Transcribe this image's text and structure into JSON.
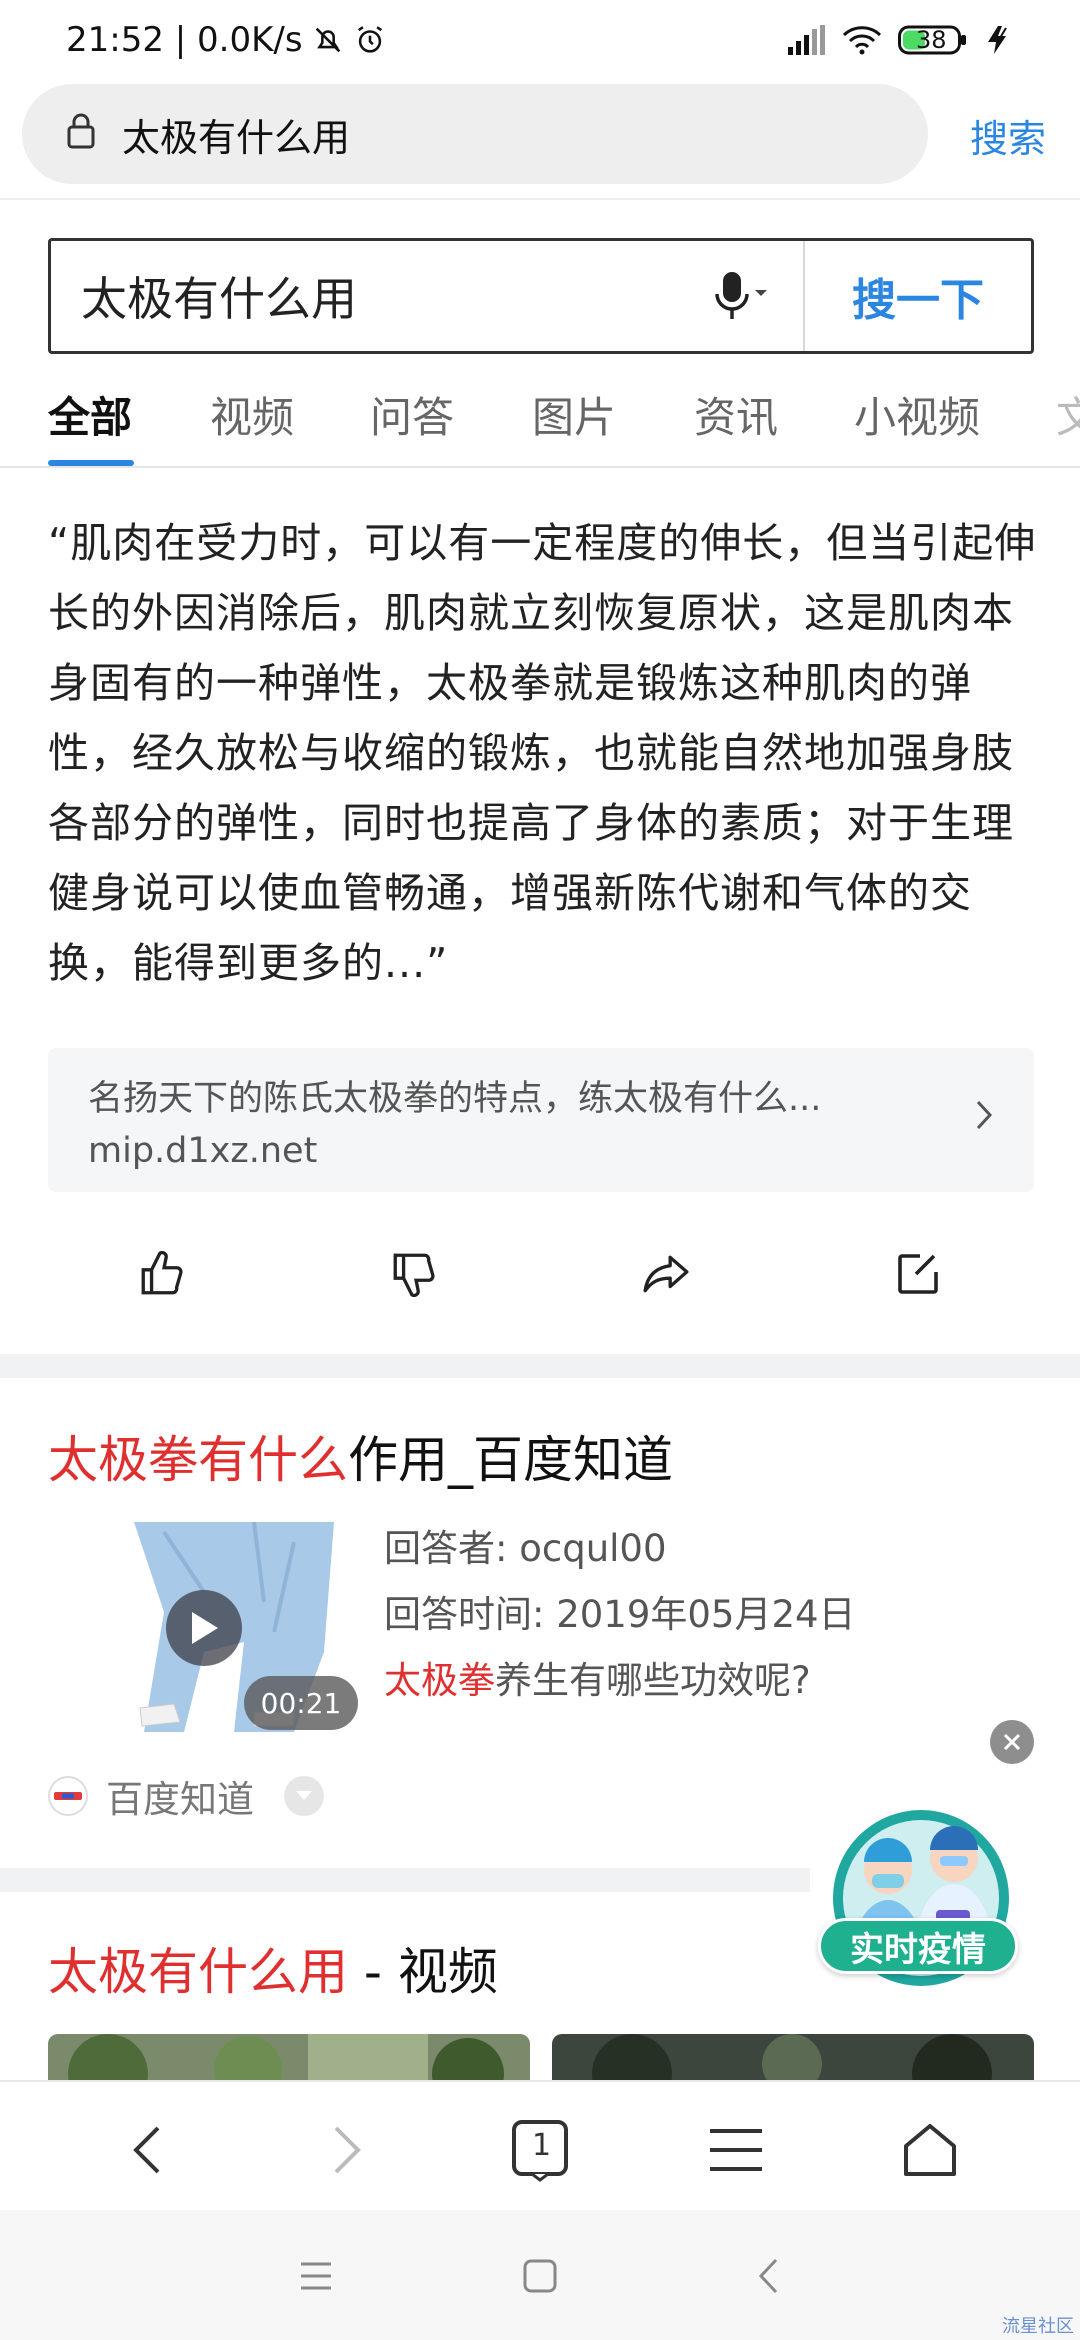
{
  "status_bar": {
    "time_speed": "21:52 | 0.0K/s",
    "battery": "38"
  },
  "address_bar": {
    "url_text": "太极有什么用",
    "search_label": "搜索"
  },
  "search_box": {
    "query": "太极有什么用",
    "button_label": "搜一下"
  },
  "tabs": [
    {
      "label": "全部",
      "active": true
    },
    {
      "label": "视频"
    },
    {
      "label": "问答"
    },
    {
      "label": "图片"
    },
    {
      "label": "资讯"
    },
    {
      "label": "小视频"
    },
    {
      "label": "文"
    }
  ],
  "answer": {
    "text": "“肌肉在受力时，可以有一定程度的伸长，但当引起伸长的外因消除后，肌肉就立刻恢复原状，这是肌肉本身固有的一种弹性，太极拳就是锻炼这种肌肉的弹性，经久放松与收缩的锻炼，也就能自然地加强身肢各部分的弹性，同时也提高了身体的素质；对于生理健身说可以使血管畅通，增强新陈代谢和气体的交换，能得到更多的...”",
    "source_title": "名扬天下的陈氏太极拳的特点，练太极有什么...",
    "source_url": "mip.d1xz.net"
  },
  "result_zhidao": {
    "title_highlight": "太极拳有什么",
    "title_rest": "作用_百度知道",
    "answerer": "回答者: ocqul00",
    "answer_time": "回答时间: 2019年05月24日",
    "question_highlight": "太极拳",
    "question_rest": "养生有哪些功效呢?",
    "duration": "00:21",
    "site": "百度知道"
  },
  "covid_badge": {
    "label": "实时疫情"
  },
  "result_video": {
    "title_highlight": "太极有什么用",
    "title_rest": " - 视频"
  },
  "toolbar": {
    "tab_count": "1"
  },
  "watermark": "流星社区",
  "colors": {
    "accent_blue": "#2b86e2",
    "highlight_red": "#e02f2f",
    "badge_green": "#1fb08f"
  }
}
